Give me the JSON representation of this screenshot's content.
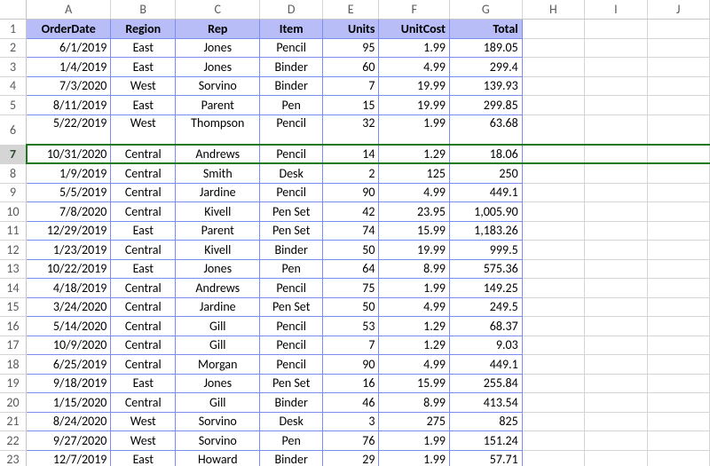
{
  "columns_letters": [
    "A",
    "B",
    "C",
    "D",
    "E",
    "F",
    "G",
    "H",
    "I",
    "J"
  ],
  "row_numbers": [
    1,
    2,
    3,
    4,
    5,
    6,
    7,
    8,
    9,
    10,
    11,
    12,
    13,
    14,
    15,
    16,
    17,
    18,
    19,
    20,
    21,
    22,
    23
  ],
  "selected_row": 7,
  "headers": [
    "OrderDate",
    "Region",
    "Rep",
    "Item",
    "Units",
    "UnitCost",
    "Total"
  ],
  "rows": [
    {
      "OrderDate": "6/1/2019",
      "Region": "East",
      "Rep": "Jones",
      "Item": "Pencil",
      "Units": "95",
      "UnitCost": "1.99",
      "Total": "189.05"
    },
    {
      "OrderDate": "1/4/2019",
      "Region": "East",
      "Rep": "Jones",
      "Item": "Binder",
      "Units": "60",
      "UnitCost": "4.99",
      "Total": "299.4"
    },
    {
      "OrderDate": "7/3/2020",
      "Region": "West",
      "Rep": "Sorvino",
      "Item": "Binder",
      "Units": "7",
      "UnitCost": "19.99",
      "Total": "139.93"
    },
    {
      "OrderDate": "8/11/2019",
      "Region": "East",
      "Rep": "Parent",
      "Item": "Pen",
      "Units": "15",
      "UnitCost": "19.99",
      "Total": "299.85"
    },
    {
      "OrderDate": "5/22/2019",
      "Region": "West",
      "Rep": "Thompson",
      "Item": "Pencil",
      "Units": "32",
      "UnitCost": "1.99",
      "Total": "63.68"
    },
    {
      "OrderDate": "10/31/2020",
      "Region": "Central",
      "Rep": "Andrews",
      "Item": "Pencil",
      "Units": "14",
      "UnitCost": "1.29",
      "Total": "18.06"
    },
    {
      "OrderDate": "1/9/2019",
      "Region": "Central",
      "Rep": "Smith",
      "Item": "Desk",
      "Units": "2",
      "UnitCost": "125",
      "Total": "250"
    },
    {
      "OrderDate": "5/5/2019",
      "Region": "Central",
      "Rep": "Jardine",
      "Item": "Pencil",
      "Units": "90",
      "UnitCost": "4.99",
      "Total": "449.1"
    },
    {
      "OrderDate": "7/8/2020",
      "Region": "Central",
      "Rep": "Kivell",
      "Item": "Pen Set",
      "Units": "42",
      "UnitCost": "23.95",
      "Total": "1,005.90"
    },
    {
      "OrderDate": "12/29/2019",
      "Region": "East",
      "Rep": "Parent",
      "Item": "Pen Set",
      "Units": "74",
      "UnitCost": "15.99",
      "Total": "1,183.26"
    },
    {
      "OrderDate": "1/23/2019",
      "Region": "Central",
      "Rep": "Kivell",
      "Item": "Binder",
      "Units": "50",
      "UnitCost": "19.99",
      "Total": "999.5"
    },
    {
      "OrderDate": "10/22/2019",
      "Region": "East",
      "Rep": "Jones",
      "Item": "Pen",
      "Units": "64",
      "UnitCost": "8.99",
      "Total": "575.36"
    },
    {
      "OrderDate": "4/18/2019",
      "Region": "Central",
      "Rep": "Andrews",
      "Item": "Pencil",
      "Units": "75",
      "UnitCost": "1.99",
      "Total": "149.25"
    },
    {
      "OrderDate": "3/24/2020",
      "Region": "Central",
      "Rep": "Jardine",
      "Item": "Pen Set",
      "Units": "50",
      "UnitCost": "4.99",
      "Total": "249.5"
    },
    {
      "OrderDate": "5/14/2020",
      "Region": "Central",
      "Rep": "Gill",
      "Item": "Pencil",
      "Units": "53",
      "UnitCost": "1.29",
      "Total": "68.37"
    },
    {
      "OrderDate": "10/9/2020",
      "Region": "Central",
      "Rep": "Gill",
      "Item": "Pencil",
      "Units": "7",
      "UnitCost": "1.29",
      "Total": "9.03"
    },
    {
      "OrderDate": "6/25/2019",
      "Region": "Central",
      "Rep": "Morgan",
      "Item": "Pencil",
      "Units": "90",
      "UnitCost": "4.99",
      "Total": "449.1"
    },
    {
      "OrderDate": "9/18/2019",
      "Region": "East",
      "Rep": "Jones",
      "Item": "Pen Set",
      "Units": "16",
      "UnitCost": "15.99",
      "Total": "255.84"
    },
    {
      "OrderDate": "1/15/2020",
      "Region": "Central",
      "Rep": "Gill",
      "Item": "Binder",
      "Units": "46",
      "UnitCost": "8.99",
      "Total": "413.54"
    },
    {
      "OrderDate": "8/24/2020",
      "Region": "West",
      "Rep": "Sorvino",
      "Item": "Desk",
      "Units": "3",
      "UnitCost": "275",
      "Total": "825"
    },
    {
      "OrderDate": "9/27/2020",
      "Region": "West",
      "Rep": "Sorvino",
      "Item": "Pen",
      "Units": "76",
      "UnitCost": "1.99",
      "Total": "151.24"
    },
    {
      "OrderDate": "12/7/2019",
      "Region": "East",
      "Rep": "Howard",
      "Item": "Binder",
      "Units": "29",
      "UnitCost": "1.99",
      "Total": "57.71"
    }
  ],
  "chart_data": {
    "type": "table",
    "title": "",
    "columns": [
      "OrderDate",
      "Region",
      "Rep",
      "Item",
      "Units",
      "UnitCost",
      "Total"
    ],
    "records": [
      [
        "6/1/2019",
        "East",
        "Jones",
        "Pencil",
        95,
        1.99,
        189.05
      ],
      [
        "1/4/2019",
        "East",
        "Jones",
        "Binder",
        60,
        4.99,
        299.4
      ],
      [
        "7/3/2020",
        "West",
        "Sorvino",
        "Binder",
        7,
        19.99,
        139.93
      ],
      [
        "8/11/2019",
        "East",
        "Parent",
        "Pen",
        15,
        19.99,
        299.85
      ],
      [
        "5/22/2019",
        "West",
        "Thompson",
        "Pencil",
        32,
        1.99,
        63.68
      ],
      [
        "10/31/2020",
        "Central",
        "Andrews",
        "Pencil",
        14,
        1.29,
        18.06
      ],
      [
        "1/9/2019",
        "Central",
        "Smith",
        "Desk",
        2,
        125,
        250
      ],
      [
        "5/5/2019",
        "Central",
        "Jardine",
        "Pencil",
        90,
        4.99,
        449.1
      ],
      [
        "7/8/2020",
        "Central",
        "Kivell",
        "Pen Set",
        42,
        23.95,
        1005.9
      ],
      [
        "12/29/2019",
        "East",
        "Parent",
        "Pen Set",
        74,
        15.99,
        1183.26
      ],
      [
        "1/23/2019",
        "Central",
        "Kivell",
        "Binder",
        50,
        19.99,
        999.5
      ],
      [
        "10/22/2019",
        "East",
        "Jones",
        "Pen",
        64,
        8.99,
        575.36
      ],
      [
        "4/18/2019",
        "Central",
        "Andrews",
        "Pencil",
        75,
        1.99,
        149.25
      ],
      [
        "3/24/2020",
        "Central",
        "Jardine",
        "Pen Set",
        50,
        4.99,
        249.5
      ],
      [
        "5/14/2020",
        "Central",
        "Gill",
        "Pencil",
        53,
        1.29,
        68.37
      ],
      [
        "10/9/2020",
        "Central",
        "Gill",
        "Pencil",
        7,
        1.29,
        9.03
      ],
      [
        "6/25/2019",
        "Central",
        "Morgan",
        "Pencil",
        90,
        4.99,
        449.1
      ],
      [
        "9/18/2019",
        "East",
        "Jones",
        "Pen Set",
        16,
        15.99,
        255.84
      ],
      [
        "1/15/2020",
        "Central",
        "Gill",
        "Binder",
        46,
        8.99,
        413.54
      ],
      [
        "8/24/2020",
        "West",
        "Sorvino",
        "Desk",
        3,
        275,
        825
      ],
      [
        "9/27/2020",
        "West",
        "Sorvino",
        "Pen",
        76,
        1.99,
        151.24
      ],
      [
        "12/7/2019",
        "East",
        "Howard",
        "Binder",
        29,
        1.99,
        57.71
      ]
    ]
  }
}
